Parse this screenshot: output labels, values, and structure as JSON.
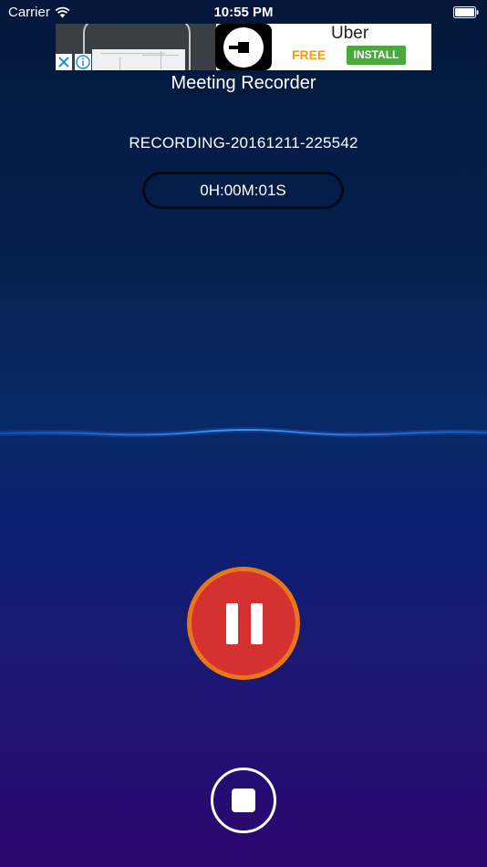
{
  "status_bar": {
    "carrier": "Carrier",
    "time": "10:55 PM",
    "wifi_icon": "wifi-icon",
    "battery_icon": "battery-icon"
  },
  "ad": {
    "title": "Uber",
    "free_label": "FREE",
    "install_label": "INSTALL",
    "close_icon": "close-icon",
    "info_icon": "info-icon",
    "colors": {
      "free": "#f19a1b",
      "install_bg": "#4aa83e",
      "close": "#1d8fd8"
    }
  },
  "app": {
    "title": "Meeting Recorder"
  },
  "recording": {
    "name": "RECORDING-20161211-225542",
    "elapsed": "0H:00M:01S"
  },
  "controls": {
    "pause_icon": "pause-icon",
    "stop_icon": "stop-icon",
    "colors": {
      "pause_fill": "#d63131",
      "pause_ring": "#e8761d",
      "waveform": "#2f8cff"
    }
  }
}
